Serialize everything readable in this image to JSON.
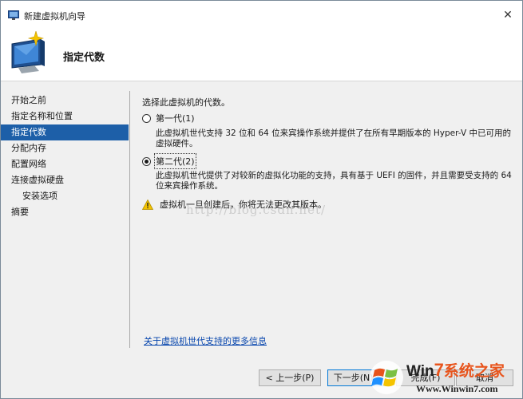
{
  "window": {
    "title": "新建虚拟机向导",
    "close_glyph": "✕"
  },
  "header": {
    "page_title": "指定代数",
    "icon": "virtual-machine-wizard-icon"
  },
  "steps": [
    {
      "label": "开始之前",
      "active": false,
      "sub": false
    },
    {
      "label": "指定名称和位置",
      "active": false,
      "sub": false
    },
    {
      "label": "指定代数",
      "active": true,
      "sub": false
    },
    {
      "label": "分配内存",
      "active": false,
      "sub": false
    },
    {
      "label": "配置网络",
      "active": false,
      "sub": false
    },
    {
      "label": "连接虚拟硬盘",
      "active": false,
      "sub": false
    },
    {
      "label": "安装选项",
      "active": false,
      "sub": true
    },
    {
      "label": "摘要",
      "active": false,
      "sub": false
    }
  ],
  "content": {
    "prompt": "选择此虚拟机的代数。",
    "options": [
      {
        "label": "第一代(1)",
        "selected": false,
        "description": "此虚拟机世代支持 32 位和 64 位来宾操作系统并提供了在所有早期版本的 Hyper-V 中已可用的虚拟硬件。"
      },
      {
        "label": "第二代(2)",
        "selected": true,
        "description": "此虚拟机世代提供了对较新的虚拟化功能的支持，具有基于 UEFI 的固件，并且需要受支持的 64 位来宾操作系统。"
      }
    ],
    "warning": "虚拟机一旦创建后，你将无法更改其版本。",
    "watermark": "http://blog.csdn.net/",
    "more_info_link": "关于虚拟机世代支持的更多信息"
  },
  "footer": {
    "back_label": "< 上一步(P)",
    "next_label": "下一步(N) >",
    "finish_label": "完成(F)",
    "cancel_label": "取消"
  },
  "logo": {
    "text_win": "Win",
    "text_seven": "7",
    "text_cn": "系统之家",
    "url": "Www.Winwin7.com"
  },
  "colors": {
    "accent": "#1d5fa8",
    "link": "#0645ad",
    "warning": "#f2c200",
    "panel_bg": "#f0f0f0"
  }
}
